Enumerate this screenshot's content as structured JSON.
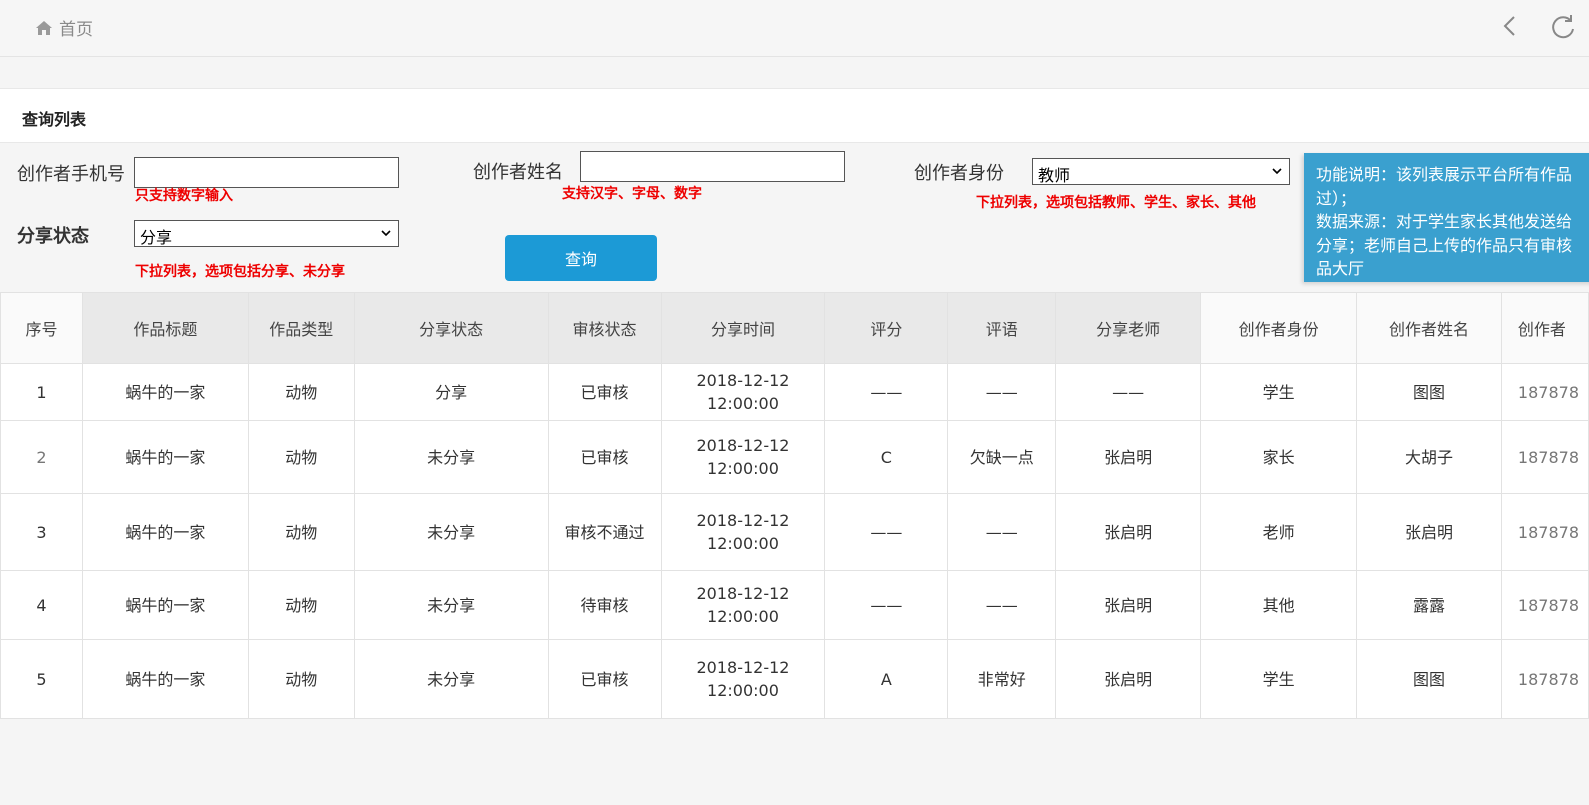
{
  "breadcrumb": {
    "home_label": "首页"
  },
  "panel": {
    "title": "查询列表"
  },
  "filters": {
    "phone": {
      "label": "创作者手机号",
      "value": "",
      "hint": "只支持数字输入"
    },
    "name": {
      "label": "创作者姓名",
      "value": "",
      "hint": "支持汉字、字母、数字"
    },
    "identity": {
      "label": "创作者身份",
      "selected": "教师",
      "hint": "下拉列表，选项包括教师、学生、家长、其他"
    },
    "share_status": {
      "label": "分享状态",
      "selected": "分享",
      "hint": "下拉列表，选项包括分享、未分享"
    }
  },
  "query_button": "查询",
  "note": {
    "lines": [
      "功能说明：该列表展示平台所有作品",
      "过）；",
      "数据来源：对于学生家长其他发送给",
      "分享；老师自己上传的作品只有审核",
      "品大厅"
    ]
  },
  "table": {
    "headers": [
      "序号",
      "作品标题",
      "作品类型",
      "分享状态",
      "审核状态",
      "分享时间",
      "评分",
      "评语",
      "分享老师",
      "创作者身份",
      "创作者姓名",
      "创作者"
    ],
    "rows": [
      {
        "no": "1",
        "title": "蜗牛的一家",
        "type": "动物",
        "share": "分享",
        "audit": "已审核",
        "date": "2018-12-12",
        "time": "12:00:00",
        "score": "——",
        "comment": "——",
        "teacher": "——",
        "identity": "学生",
        "name": "图图",
        "phone": "187878"
      },
      {
        "no": "2",
        "title": "蜗牛的一家",
        "type": "动物",
        "share": "未分享",
        "audit": "已审核",
        "date": "2018-12-12",
        "time": "12:00:00",
        "score": "C",
        "comment": "欠缺一点",
        "teacher": "张启明",
        "identity": "家长",
        "name": "大胡子",
        "phone": "187878"
      },
      {
        "no": "3",
        "title": "蜗牛的一家",
        "type": "动物",
        "share": "未分享",
        "audit": "审核不通过",
        "date": "2018-12-12",
        "time": "12:00:00",
        "score": "——",
        "comment": "——",
        "teacher": "张启明",
        "identity": "老师",
        "name": "张启明",
        "phone": "187878"
      },
      {
        "no": "4",
        "title": "蜗牛的一家",
        "type": "动物",
        "share": "未分享",
        "audit": "待审核",
        "date": "2018-12-12",
        "time": "12:00:00",
        "score": "——",
        "comment": "——",
        "teacher": "张启明",
        "identity": "其他",
        "name": "露露",
        "phone": "187878"
      },
      {
        "no": "5",
        "title": "蜗牛的一家",
        "type": "动物",
        "share": "未分享",
        "audit": "已审核",
        "date": "2018-12-12",
        "time": "12:00:00",
        "score": "A",
        "comment": "非常好",
        "teacher": "张启明",
        "identity": "学生",
        "name": "图图",
        "phone": "187878"
      }
    ]
  },
  "icons": {
    "home": "home-icon",
    "back": "chevron-left-icon",
    "refresh": "refresh-icon",
    "dropdown": "chevron-down-icon"
  },
  "colors": {
    "primary_button": "#1c9ad6",
    "note_bg": "#3aa0cf",
    "hint": "#ee0000"
  }
}
